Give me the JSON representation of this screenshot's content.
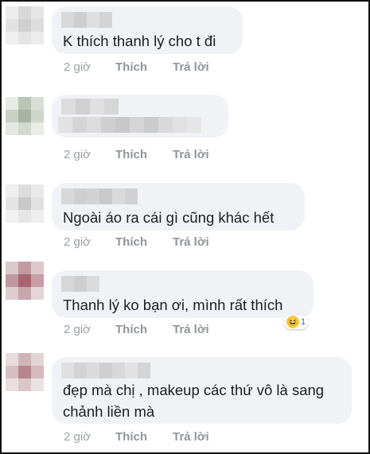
{
  "comments": [
    {
      "text": "K thích thanh lý cho t đi",
      "time": "2 giờ",
      "like": "Thích",
      "reply": "Trả lời"
    },
    {
      "text": "",
      "time": "2 giờ",
      "like": "Thích",
      "reply": "Trả lời"
    },
    {
      "text": "Ngoài áo ra cái gì cũng khác hết",
      "time": "2 giờ",
      "like": "Thích",
      "reply": "Trả lời"
    },
    {
      "text": "Thanh lý ko bạn ơi, mình rất thích",
      "time": "2 giờ",
      "like": "Thích",
      "reply": "Trả lời",
      "reaction": {
        "icon": "haha-emoji-icon",
        "count": "1"
      }
    },
    {
      "text": "đẹp mà chị , makeup các thứ vô là sang\nchảnh liền mà",
      "time": "2 giờ",
      "like": "Thích",
      "reply": "Trả lời"
    }
  ],
  "colors": {
    "bubble": "#f0f2f5",
    "text": "#1c1e21",
    "meta": "#90949c",
    "reaction": "#f7c946"
  }
}
